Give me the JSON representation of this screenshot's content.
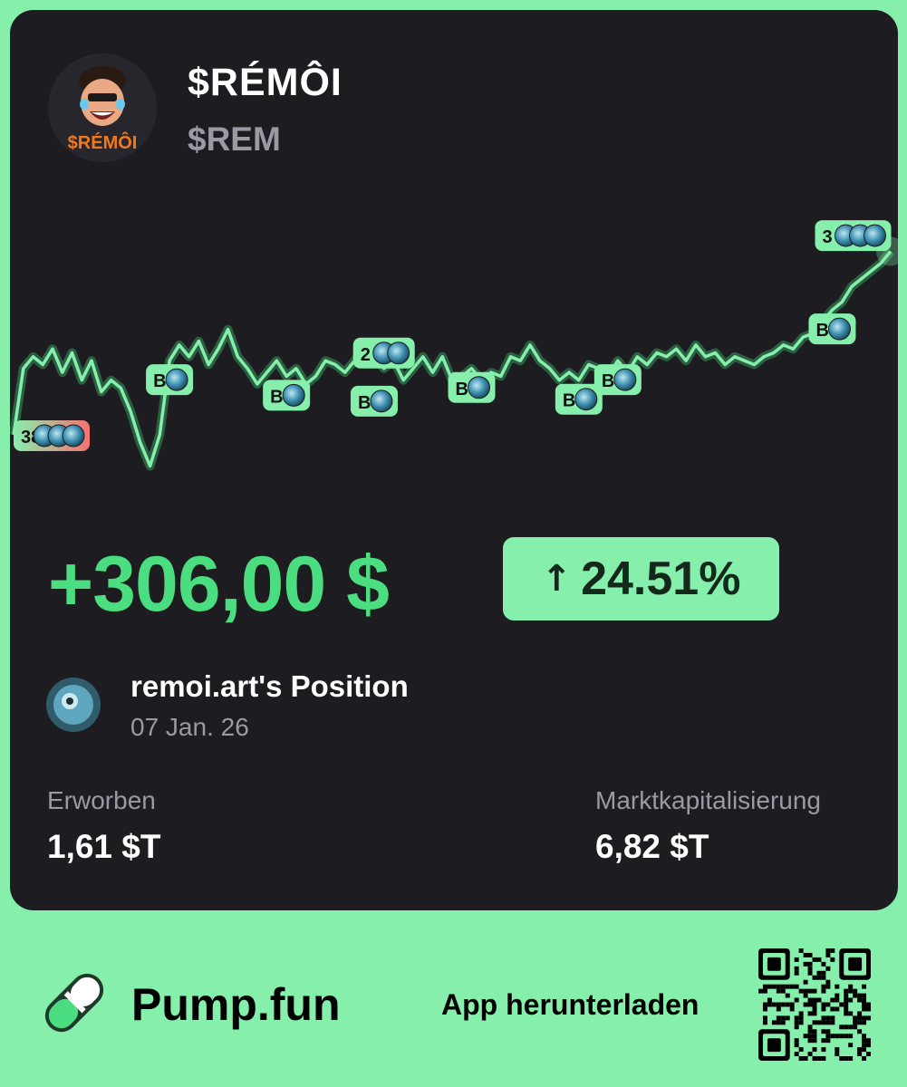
{
  "token": {
    "name": "$RÉMÔI",
    "symbol": "$REM",
    "avatar_logo_text": "$RÉMÔI"
  },
  "pnl": {
    "amount": "+306,00 $",
    "percent": "24.51%",
    "direction_icon": "arrow-up-icon"
  },
  "position": {
    "title": "remoi.art's Position",
    "date": "07 Jan. 26"
  },
  "stats": {
    "acquired_label": "Erworben",
    "acquired_value": "1,61 $T",
    "mcap_label": "Marktkapitalisierung",
    "mcap_value": "6,82 $T"
  },
  "footer": {
    "brand": "Pump.fun",
    "download_label": "App herunterladen",
    "logo_icon": "pill-icon"
  },
  "colors": {
    "background": "#86efac",
    "card": "#1c1c21",
    "positive": "#4ade80",
    "badge": "#86efac",
    "sell_badge_tail": "#f87171"
  },
  "chart_data": {
    "type": "line",
    "series": [
      {
        "values": [
          38,
          55,
          58,
          56,
          60,
          54,
          59,
          52,
          57,
          49,
          52,
          50,
          44,
          36,
          30,
          38,
          57,
          61,
          58,
          62,
          56,
          60,
          65,
          58,
          55,
          51,
          54,
          57,
          53,
          55,
          51,
          53,
          57,
          56,
          54,
          57,
          61,
          58,
          55,
          57,
          52,
          55,
          58,
          54,
          58,
          52,
          53,
          55,
          52,
          54,
          53,
          58,
          57,
          61,
          57,
          55,
          52,
          54,
          52,
          56,
          55,
          53,
          57,
          54,
          58,
          56,
          59,
          58,
          60,
          57,
          61,
          58,
          59,
          56,
          58,
          57,
          56,
          58,
          59,
          61,
          60,
          63,
          64,
          67,
          70,
          72,
          76,
          78,
          80,
          82,
          85
        ]
      }
    ],
    "markers": [
      {
        "label": "38",
        "kind": "sell",
        "index": 0
      },
      {
        "label": "B",
        "kind": "buy",
        "index": 16
      },
      {
        "label": "B",
        "kind": "buy",
        "index": 28
      },
      {
        "label": "2",
        "kind": "buy",
        "index": 38
      },
      {
        "label": "B",
        "kind": "buy",
        "index": 37
      },
      {
        "label": "B",
        "kind": "buy",
        "index": 47
      },
      {
        "label": "B",
        "kind": "buy",
        "index": 58
      },
      {
        "label": "B",
        "kind": "buy",
        "index": 62
      },
      {
        "label": "B",
        "kind": "buy",
        "index": 84
      },
      {
        "label": "3",
        "kind": "buy",
        "index": 88
      }
    ]
  }
}
